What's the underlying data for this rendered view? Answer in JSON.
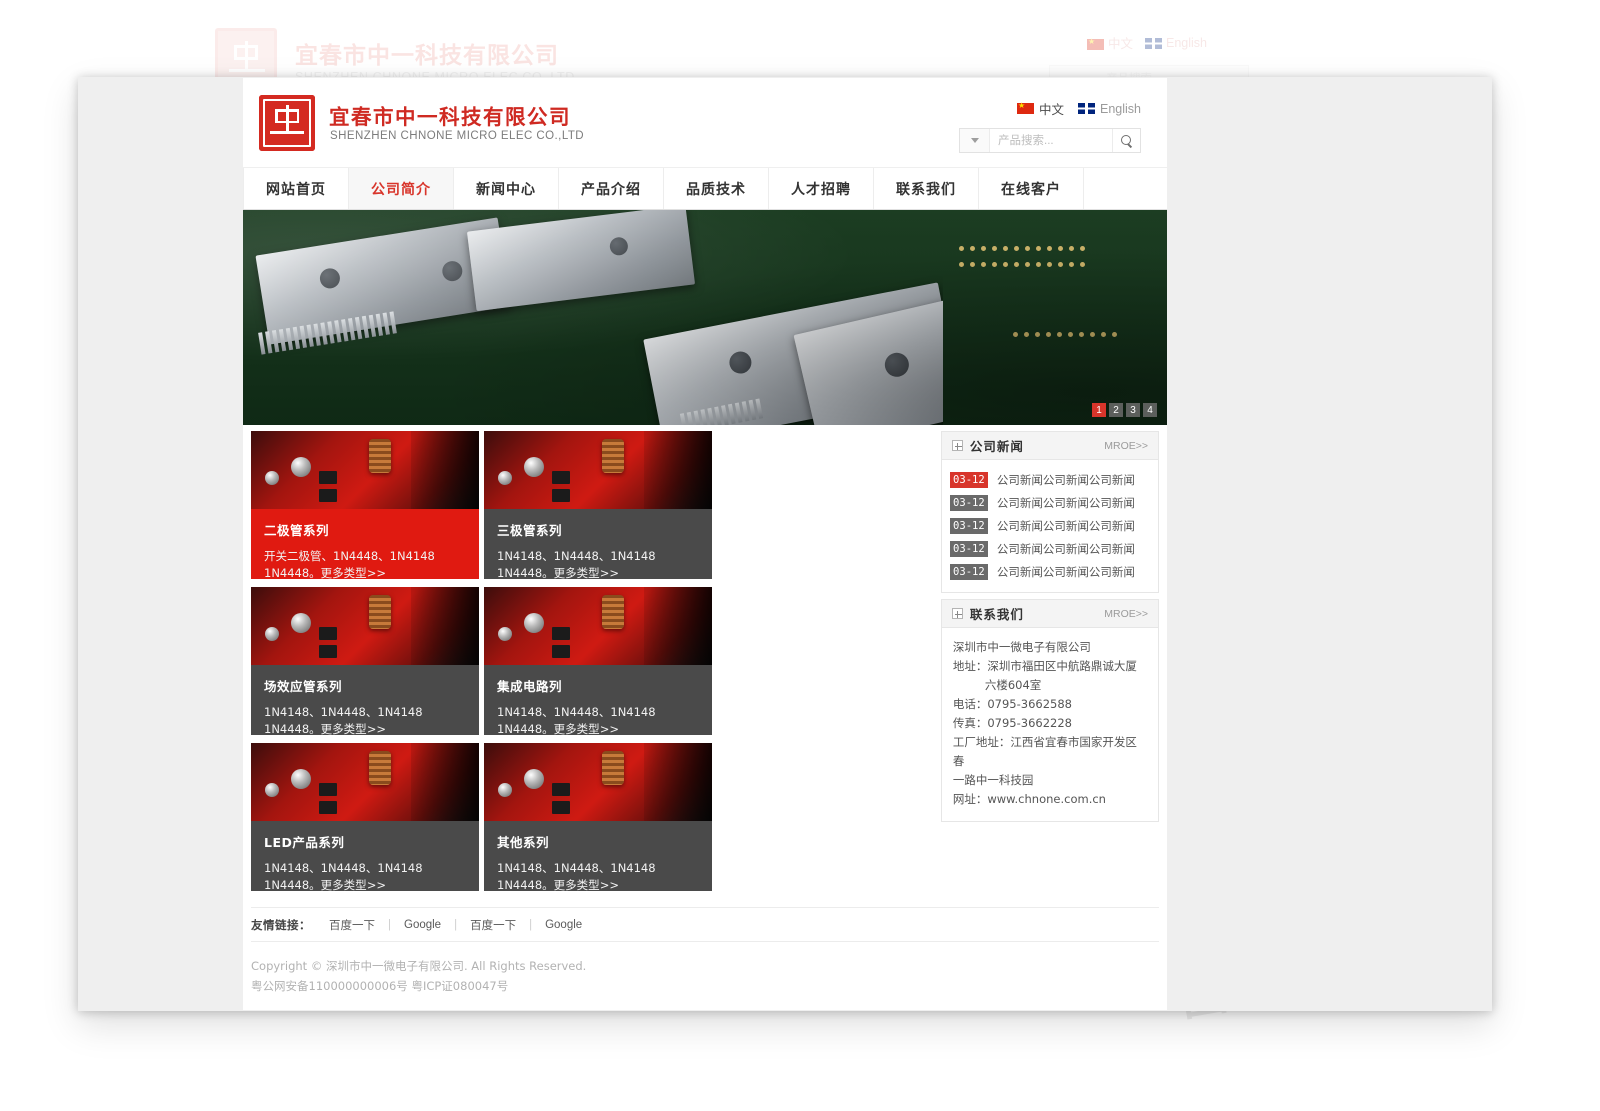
{
  "ghost_preview": {
    "brand_cn": "宜春市中一科技有限公司",
    "brand_en": "SHENZHEN CHNONE MICRO ELEC CO.,LTD",
    "lang_cn": "中文",
    "lang_en": "English",
    "search_placeholder": "产品搜索..."
  },
  "header": {
    "brand_cn": "宜春市中一科技有限公司",
    "brand_en": "SHENZHEN CHNONE MICRO ELEC CO.,LTD",
    "logo_icon": "company-seal-icon",
    "languages": [
      {
        "label": "中文",
        "flag": "cn-flag-icon",
        "active": true
      },
      {
        "label": "English",
        "flag": "uk-flag-icon",
        "active": false
      }
    ],
    "search": {
      "placeholder": "产品搜索...",
      "value": "",
      "dropdown_icon": "chevron-down-icon",
      "button_icon": "search-icon"
    }
  },
  "nav": {
    "items": [
      {
        "label": "网站首页",
        "active": false
      },
      {
        "label": "公司简介",
        "active": true
      },
      {
        "label": "新闻中心",
        "active": false
      },
      {
        "label": "产品介绍",
        "active": false
      },
      {
        "label": "品质技术",
        "active": false
      },
      {
        "label": "人才招聘",
        "active": false
      },
      {
        "label": "联系我们",
        "active": false
      },
      {
        "label": "在线客户",
        "active": false
      }
    ]
  },
  "banner": {
    "alt": "integrated-circuit-chips-photo",
    "pager": [
      {
        "label": "1",
        "active": true
      },
      {
        "label": "2",
        "active": false
      },
      {
        "label": "3",
        "active": false
      },
      {
        "label": "4",
        "active": false
      }
    ]
  },
  "products": {
    "cards": [
      {
        "title": "二极管系列",
        "line1": "开关二极管、1N4448、1N4148",
        "line2": "1N4448。更多类型",
        "more": ">>",
        "active": true
      },
      {
        "title": "三极管系列",
        "line1": "1N4148、1N4448、1N4148",
        "line2": "1N4448。更多类型",
        "more": ">>",
        "active": false
      },
      {
        "title": "场效应管系列",
        "line1": "1N4148、1N4448、1N4148",
        "line2": "1N4448。更多类型",
        "more": ">>",
        "active": false
      },
      {
        "title": "集成电路列",
        "line1": "1N4148、1N4448、1N4148",
        "line2": "1N4448。更多类型",
        "more": ">>",
        "active": false
      },
      {
        "title": "LED产品系列",
        "line1": "1N4148、1N4448、1N4148",
        "line2": "1N4448。更多类型",
        "more": ">>",
        "active": false
      },
      {
        "title": "其他系列",
        "line1": "1N4148、1N4448、1N4148",
        "line2": "1N4448。更多类型",
        "more": ">>",
        "active": false
      }
    ]
  },
  "sidebar": {
    "news": {
      "title": "公司新闻",
      "more_label": "MROE>>",
      "expand_icon": "plus-box-icon",
      "items": [
        {
          "date": "03-12",
          "text": "公司新闻公司新闻公司新闻",
          "highlight": true
        },
        {
          "date": "03-12",
          "text": "公司新闻公司新闻公司新闻",
          "highlight": false
        },
        {
          "date": "03-12",
          "text": "公司新闻公司新闻公司新闻",
          "highlight": false
        },
        {
          "date": "03-12",
          "text": "公司新闻公司新闻公司新闻",
          "highlight": false
        },
        {
          "date": "03-12",
          "text": "公司新闻公司新闻公司新闻",
          "highlight": false
        }
      ]
    },
    "contact": {
      "title": "联系我们",
      "more_label": "MROE>>",
      "expand_icon": "plus-box-icon",
      "lines": [
        "深圳市中一微电子有限公司",
        "地址：深圳市福田区中航路鼎诚大厦",
        "六楼604室",
        "电话：0795-3662588",
        "传真：0795-3662228",
        "工厂地址：江西省宜春市国家开发区春",
        "一路中一科技园",
        "网址：www.chnone.com.cn"
      ]
    }
  },
  "friend_links": {
    "label": "友情链接：",
    "links": [
      "百度一下",
      "Google",
      "百度一下",
      "Google"
    ],
    "separator": "|"
  },
  "footer": {
    "copyright": "Copyright © 深圳市中一微电子有限公司. All Rights Reserved.",
    "icp": "粤公网安备110000000006号 粤ICP证080047号"
  },
  "colors": {
    "brand_red": "#cf2a22",
    "accent_red": "#d8352b",
    "card_red": "#e01a11",
    "card_gray": "#4a4a4a",
    "page_bg": "#efefef"
  }
}
